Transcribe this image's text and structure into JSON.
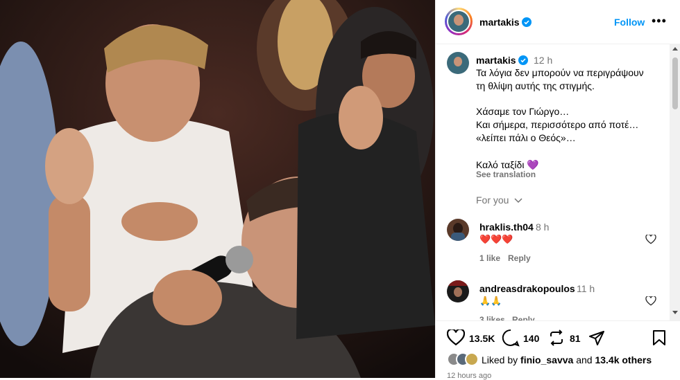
{
  "post": {
    "author": "martakis",
    "follow_label": "Follow",
    "more_label": "•••"
  },
  "caption": {
    "author": "martakis",
    "time": "12 h",
    "lines": [
      "Τα λόγια δεν μπορούν να περιγράψουν",
      "τη θλίψη αυτής της στιγμής.",
      "Χάσαμε τον Γιώργο…",
      "Και σήμερα, περισσότερο από ποτέ…",
      "«λείπει πάλι ο Θεός»…",
      "Καλό ταξίδι 💜"
    ],
    "see_translation": "See translation",
    "for_you": "For you"
  },
  "comments": [
    {
      "user": "hraklis.th04",
      "time": "8 h",
      "text": "❤️❤️❤️",
      "likes": "1 like",
      "reply": "Reply"
    },
    {
      "user": "andreasdrakopoulos",
      "time": "11 h",
      "text": "🙏🙏",
      "likes": "3 likes",
      "reply": "Reply"
    }
  ],
  "actions": {
    "likes": "13.5K",
    "comments": "140",
    "reposts": "81"
  },
  "liked_by": {
    "prefix": "Liked by",
    "user": "finio_savva",
    "and": "and",
    "others": "13.4k others"
  },
  "timestamp": "12 hours ago",
  "colors": {
    "accent": "#0095f6",
    "heart": "#ed4956",
    "muted": "#737373"
  }
}
